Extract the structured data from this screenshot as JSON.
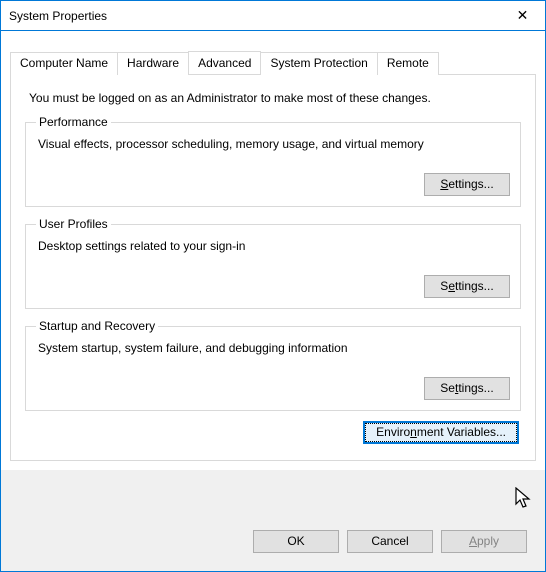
{
  "window": {
    "title": "System Properties",
    "close_icon": "✕"
  },
  "tabs": {
    "computer_name": "Computer Name",
    "hardware": "Hardware",
    "advanced": "Advanced",
    "system_protection": "System Protection",
    "remote": "Remote"
  },
  "admin_note": "You must be logged on as an Administrator to make most of these changes.",
  "groups": {
    "performance": {
      "legend": "Performance",
      "desc": "Visual effects, processor scheduling, memory usage, and virtual memory",
      "button": "Settings..."
    },
    "user_profiles": {
      "legend": "User Profiles",
      "desc": "Desktop settings related to your sign-in",
      "button": "Settings..."
    },
    "startup": {
      "legend": "Startup and Recovery",
      "desc": "System startup, system failure, and debugging information",
      "button": "Settings..."
    }
  },
  "env_button": "Environment Variables...",
  "buttons": {
    "ok": "OK",
    "cancel": "Cancel",
    "apply": "Apply"
  }
}
